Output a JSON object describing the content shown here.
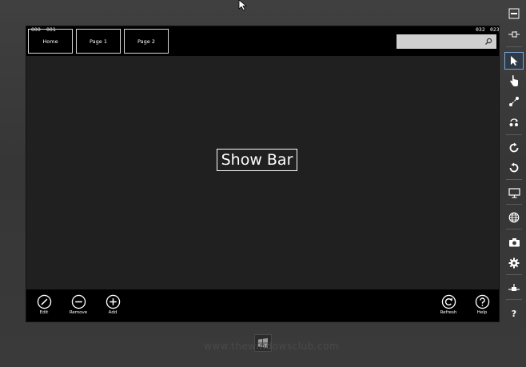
{
  "topbar": {
    "nav": [
      {
        "label": "Home"
      },
      {
        "label": "Page 1"
      },
      {
        "label": "Page 2"
      }
    ],
    "coords": {
      "left_a": "000",
      "left_b": "001",
      "right_a": "032",
      "right_b": "023"
    },
    "search": {
      "placeholder": ""
    }
  },
  "main": {
    "show_bar_label": "Show Bar"
  },
  "appbar": {
    "left": [
      {
        "label": "Edit",
        "icon": "edit-icon"
      },
      {
        "label": "Remove",
        "icon": "remove-icon"
      },
      {
        "label": "Add",
        "icon": "add-icon"
      }
    ],
    "right": [
      {
        "label": "Refresh",
        "icon": "refresh-icon"
      },
      {
        "label": "Help",
        "icon": "help-icon"
      }
    ]
  },
  "toolbar": {
    "items": [
      "minimize-icon",
      "pin-icon",
      "pointer-icon",
      "touch-icon",
      "pinch-icon",
      "rotate-gesture-icon",
      "rotate-clockwise-icon",
      "rotate-counterclockwise-icon",
      "resolution-icon",
      "network-icon",
      "screenshot-icon",
      "settings-icon",
      "remote-connect-icon",
      "help-icon"
    ],
    "help_label": "?"
  },
  "watermark": "www.thewindowsclub.com",
  "colors": {
    "screen": "#202020",
    "bar": "#000000",
    "search": "#cfcfcf",
    "bezel": "#3a3a3a"
  }
}
